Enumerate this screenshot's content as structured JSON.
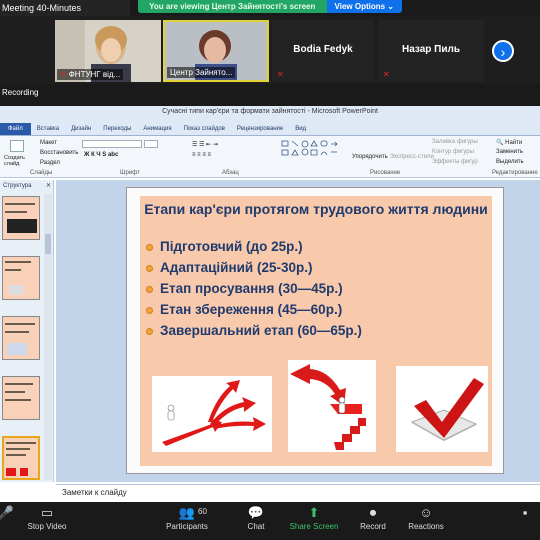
{
  "meeting": {
    "title": "Meeting 40-Minutes",
    "banner": "You are viewing Центр Зайнятості's screen",
    "view_options": "View Options"
  },
  "participants": [
    {
      "name": "ФНТУНГ від..."
    },
    {
      "name": "Центр Зайнято..."
    },
    {
      "name": "Bodia Fedyk"
    },
    {
      "name": "Назар Пиль"
    }
  ],
  "recording_label": "Recording",
  "ppt": {
    "window_title": "Сучасні типи кар'єри та формати зайнятості - Microsoft PowerPoint",
    "tabs": [
      "Файл",
      "Вставка",
      "Дизайн",
      "Переходы",
      "Анимация",
      "Показ слайдов",
      "Рецензирование",
      "Вид"
    ],
    "ribbon": {
      "new_slide": "Создать слайд",
      "layout": "Макет",
      "reset": "Восстановить",
      "section": "Раздел",
      "group_slides": "Слайды",
      "group_font": "Шрифт",
      "group_paragraph": "Абзац",
      "group_drawing": "Рисование",
      "group_editing": "Редактирование",
      "arrange": "Упорядочить",
      "quick_styles": "Экспресс-стили",
      "shape_fill": "Заливка фигуры",
      "shape_outline": "Контур фигуры",
      "shape_effects": "Эффекты фигур",
      "find": "Найти",
      "replace": "Заменить",
      "select": "Выделить"
    },
    "outline_tab": "Структура",
    "notes": "Заметки к слайду"
  },
  "slide": {
    "title": "Етапи кар'єри протягом трудового життя людини",
    "bullets": [
      "Підготовчий (до 25р.)",
      "Адаптаційний (25-30р.)",
      "Етап просування (30—45р.)",
      "Етан збереження (45—60р.)",
      "Завершальний етап (60—65р.)"
    ]
  },
  "toolbar": {
    "unmute": "",
    "stop_video": "Stop Video",
    "participants": "Participants",
    "participant_count": "60",
    "chat": "Chat",
    "share": "Share Screen",
    "record": "Record",
    "reactions": "Reactions"
  },
  "colors": {
    "share_green": "#3cc06b",
    "zoom_blue": "#0e71eb",
    "slide_bg": "#f9c9ac",
    "slide_text": "#1f3b6e",
    "bullet": "#f2a33a",
    "arrow_red": "#e01818"
  }
}
